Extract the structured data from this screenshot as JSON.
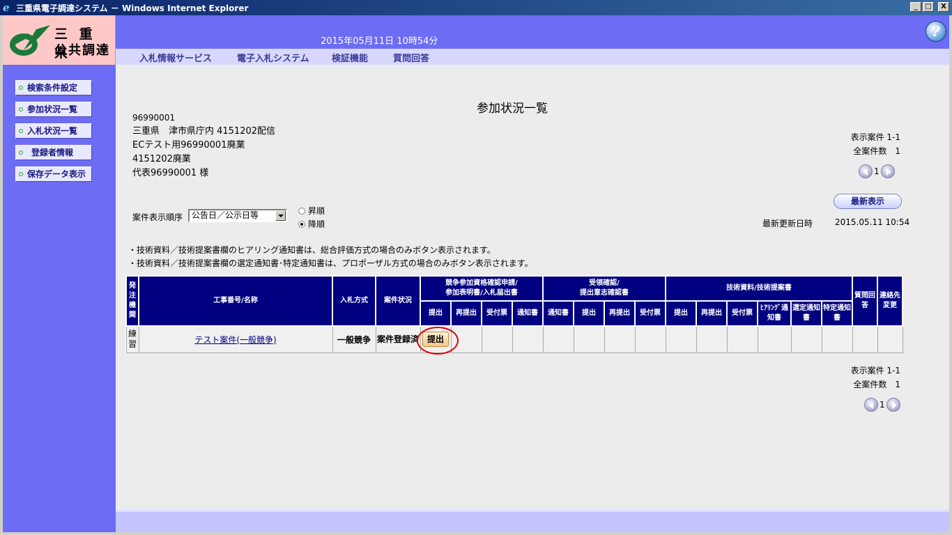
{
  "window": {
    "title": "三重県電子調達システム － Windows Internet Explorer",
    "minimize": "_",
    "maximize": "□",
    "close": "X"
  },
  "header": {
    "logo_line1": "三 重 県",
    "logo_line2": "公共調達",
    "datetime": "2015年05月11日 10時54分",
    "help_glyph": "?"
  },
  "menu": [
    {
      "label": "入札情報サービス"
    },
    {
      "label": "電子入札システム"
    },
    {
      "label": "検証機能"
    },
    {
      "label": "質問回答"
    }
  ],
  "sidebar": [
    {
      "label": "検索条件設定"
    },
    {
      "label": "参加状況一覧"
    },
    {
      "label": "入札状況一覧"
    },
    {
      "label": "登録者情報"
    },
    {
      "label": "保存データ表示"
    }
  ],
  "page": {
    "title": "参加状況一覧",
    "addr": [
      "96990001",
      "三重県　津市県庁内 4151202配信",
      "ECテスト用96990001廃業",
      "4151202廃業",
      "代表96990001 様"
    ],
    "top_info": {
      "display": "表示案件 1-1",
      "total": "全案件数　1",
      "page": "1"
    },
    "refresh_label": "最新表示",
    "last_updated_label": "最新更新日時",
    "last_updated_value": "2015.05.11 10:54",
    "sort_label": "案件表示順序",
    "sort_value": "公告日／公示日等",
    "radio_asc": "昇順",
    "radio_desc": "降順",
    "notes": [
      "・技術資料／技術提案書欄のヒアリング通知書は、総合評価方式の場合のみボタン表示されます。",
      "・技術資料／技術提案書欄の選定通知書･特定通知書は、プロポーザル方式の場合のみボタン表示されます。"
    ],
    "bottom_info": {
      "display": "表示案件 1-1",
      "total": "全案件数　1",
      "page": "1"
    }
  },
  "table": {
    "headers": {
      "kikan": "発注機関",
      "name": "工事番号/名称",
      "method": "入札方式",
      "status": "案件状況",
      "group1": "競争参加資格確認申請/\n参加表明書/入札届出書",
      "group2": "受領確認/\n提出意志確認書",
      "group3": "技術資料/技術提案書",
      "question": "質問回答",
      "contact": "連絡先変更",
      "g1": [
        "提出",
        "再提出",
        "受付票",
        "通知書"
      ],
      "g2": [
        "通知書",
        "提出",
        "再提出",
        "受付票"
      ],
      "g3": [
        "提出",
        "再提出",
        "受付票",
        "ﾋｱﾘﾝｸﾞ通知書",
        "選定通知書",
        "特定通知書"
      ]
    },
    "row": {
      "kikan": "練習",
      "name": "テスト案件(一般競争)",
      "method": "一般競争",
      "status": "案件登録済",
      "submit": "提出"
    }
  }
}
